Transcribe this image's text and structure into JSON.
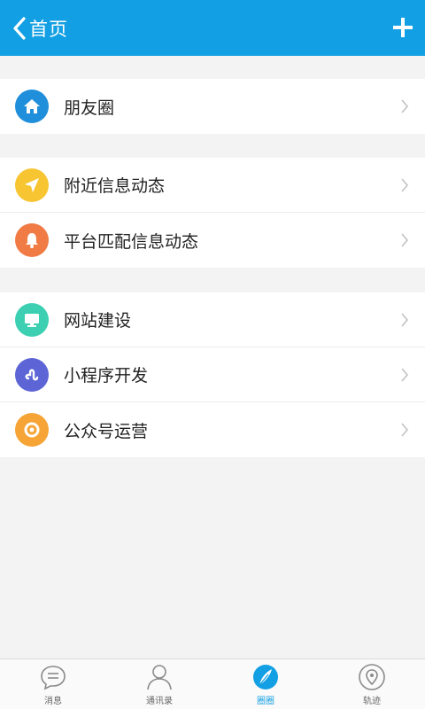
{
  "header": {
    "back_label": "首页",
    "add_icon": "plus-icon"
  },
  "groups": [
    {
      "items": [
        {
          "label": "朋友圈",
          "icon": "home-icon",
          "color": "#1f8fdb"
        }
      ]
    },
    {
      "items": [
        {
          "label": "附近信息动态",
          "icon": "location-arrow-icon",
          "color": "#f7c532"
        },
        {
          "label": "平台匹配信息动态",
          "icon": "bell-icon",
          "color": "#f07b45"
        }
      ]
    },
    {
      "items": [
        {
          "label": "网站建设",
          "icon": "monitor-icon",
          "color": "#3ccfb2"
        },
        {
          "label": "小程序开发",
          "icon": "mini-program-icon",
          "color": "#5d65d6"
        },
        {
          "label": "公众号运营",
          "icon": "lifebuoy-icon",
          "color": "#f5a435"
        }
      ]
    }
  ],
  "tabs": [
    {
      "label": "消息",
      "icon": "chat-icon",
      "active": false
    },
    {
      "label": "通讯录",
      "icon": "contacts-icon",
      "active": false
    },
    {
      "label": "圈圈",
      "icon": "discover-icon",
      "active": true
    },
    {
      "label": "轨迹",
      "icon": "map-pin-icon",
      "active": false
    }
  ],
  "colors": {
    "accent": "#129fe3",
    "background": "#f3f3f3"
  }
}
